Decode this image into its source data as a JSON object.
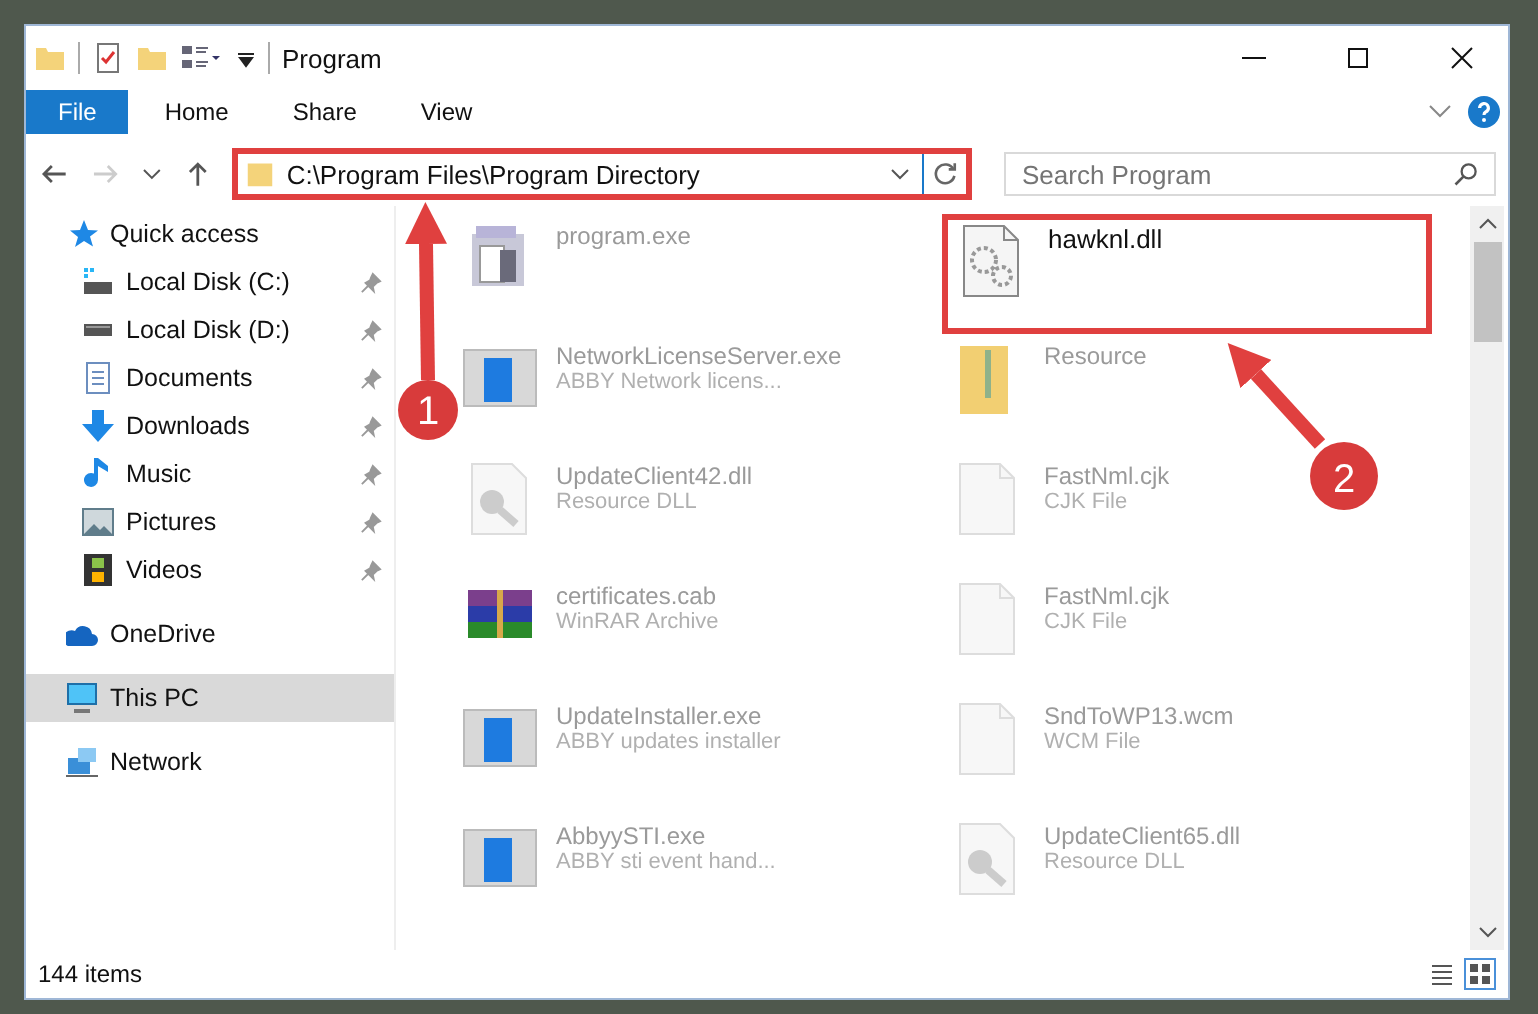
{
  "window": {
    "title": "Program"
  },
  "ribbon_tabs": [
    {
      "label": "File",
      "kind": "file",
      "selected": false
    },
    {
      "label": "Home",
      "kind": "tab",
      "selected": false
    },
    {
      "label": "Share",
      "kind": "tab",
      "selected": false
    },
    {
      "label": "View",
      "kind": "tab",
      "selected": false
    }
  ],
  "address_bar": {
    "path": "C:\\Program Files\\Program Directory",
    "highlighted": true
  },
  "search": {
    "placeholder": "Search Program"
  },
  "sidebar": {
    "items": [
      {
        "label": "Quick access",
        "kind": "star",
        "selected": false,
        "children": [
          {
            "label": "Local Disk (C:)",
            "kind": "disk-c",
            "pinned": true,
            "selected": false
          },
          {
            "label": "Local Disk (D:)",
            "kind": "disk",
            "pinned": true,
            "selected": false
          },
          {
            "label": "Documents",
            "kind": "documents",
            "pinned": true,
            "selected": false
          },
          {
            "label": "Downloads",
            "kind": "downloads",
            "pinned": true,
            "selected": false
          },
          {
            "label": "Music",
            "kind": "music",
            "pinned": true,
            "selected": false
          },
          {
            "label": "Pictures",
            "kind": "pictures",
            "pinned": true,
            "selected": false
          },
          {
            "label": "Videos",
            "kind": "videos",
            "pinned": true,
            "selected": false
          }
        ]
      },
      {
        "label": "OneDrive",
        "kind": "cloud",
        "selected": false
      },
      {
        "label": "This PC",
        "kind": "pc",
        "selected": true
      },
      {
        "label": "Network",
        "kind": "network",
        "selected": false
      }
    ]
  },
  "files": [
    {
      "name": "program.exe",
      "kind": "installer"
    },
    {
      "name": "hawknl.dll",
      "kind": "gears",
      "highlighted": true
    },
    {
      "name": "NetworkLicenseServer.exe",
      "type": "ABBY Network licens...",
      "kind": "app"
    },
    {
      "name": "Resource",
      "kind": "folder"
    },
    {
      "name": "UpdateClient42.dll",
      "type": "Resource DLL",
      "kind": "dll"
    },
    {
      "name": "FastNml.cjk",
      "type": "CJK File",
      "kind": "file"
    },
    {
      "name": "certificates.cab",
      "type": "WinRAR Archive",
      "kind": "archive"
    },
    {
      "name": "FastNml.cjk",
      "type": "CJK File",
      "kind": "file"
    },
    {
      "name": "UpdateInstaller.exe",
      "type": "ABBY updates installer",
      "kind": "app"
    },
    {
      "name": "SndToWP13.wcm",
      "type": "WCM File",
      "kind": "file"
    },
    {
      "name": "AbbyySTI.exe",
      "type": "ABBY sti event hand...",
      "kind": "app"
    },
    {
      "name": "UpdateClient65.dll",
      "type": "Resource DLL",
      "kind": "dll"
    }
  ],
  "status_bar": {
    "count": "144 items"
  },
  "annotations": [
    {
      "number": "1"
    },
    {
      "number": "2"
    }
  ]
}
